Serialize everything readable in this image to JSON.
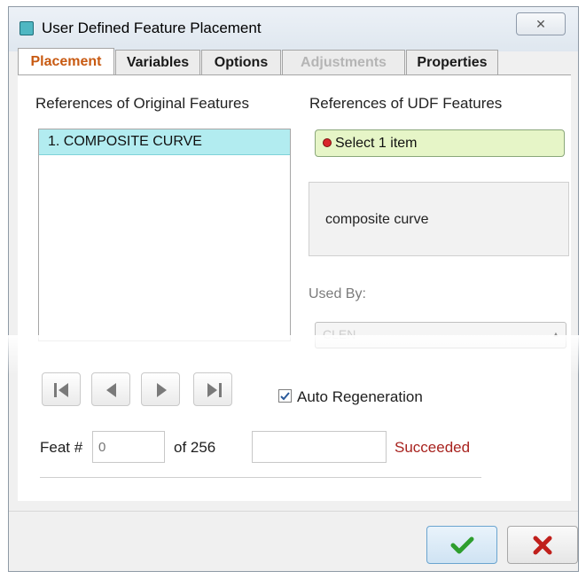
{
  "window": {
    "title": "User Defined Feature Placement",
    "close_glyph": "✕"
  },
  "tabs": [
    {
      "label": "Placement",
      "state": "active"
    },
    {
      "label": "Variables",
      "state": "normal"
    },
    {
      "label": "Options",
      "state": "normal"
    },
    {
      "label": "Adjustments",
      "state": "disabled"
    },
    {
      "label": "Properties",
      "state": "normal"
    }
  ],
  "placement": {
    "original_header": "References of Original Features",
    "udf_header": "References of UDF Features",
    "original_items": [
      "1. COMPOSITE CURVE"
    ],
    "select_prompt": "Select 1 item",
    "reference_description": "composite curve",
    "used_by_label": "Used By:",
    "used_by_value": "CLEN"
  },
  "navigation": {
    "buttons": [
      "first-icon",
      "previous-icon",
      "next-icon",
      "last-icon"
    ]
  },
  "auto_regeneration": {
    "label": "Auto Regeneration",
    "checked": true
  },
  "feat": {
    "label": "Feat #",
    "placeholder": "0",
    "of_text": "of 256",
    "status": "Succeeded"
  },
  "colors": {
    "active_tab_text": "#c85a12",
    "selected_list_item": "#b2ecf0",
    "select_box_bg": "#e6f5c7",
    "status_text": "#a8231f",
    "ok_check": "#2e9e2e",
    "cancel_x": "#c0201c"
  }
}
